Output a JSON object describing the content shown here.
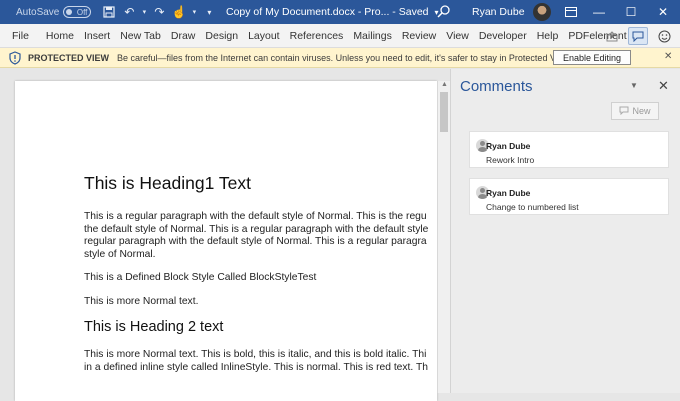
{
  "titlebar": {
    "autosave_label": "AutoSave",
    "autosave_state": "Off",
    "doc_title": "Copy of My Document.docx  -  Pro...  -  Saved",
    "user_name": "Ryan Dube"
  },
  "ribbon": {
    "tabs": [
      "File",
      "Home",
      "Insert",
      "New Tab",
      "Draw",
      "Design",
      "Layout",
      "References",
      "Mailings",
      "Review",
      "View",
      "Developer",
      "Help",
      "PDFelement"
    ]
  },
  "protected_view": {
    "title": "PROTECTED VIEW",
    "message": "Be careful—files from the Internet can contain viruses. Unless you need to edit, it's safer to stay in Protected View.",
    "button": "Enable Editing"
  },
  "document": {
    "heading1": "This is Heading1 Text",
    "para1": [
      "This is a regular paragraph with the default style of Normal. This is the regu",
      "the default style of Normal. This is a regular paragraph with the default style",
      "regular paragraph with the default style of Normal. This is a regular paragra",
      "style of Normal."
    ],
    "para2": "This is a Defined Block Style Called BlockStyleTest",
    "para3": "This is more Normal text.",
    "heading2": "This is Heading 2 text",
    "para4": [
      "This is more Normal text. This is bold, this is italic, and this is bold italic. Thi",
      "in a defined inline style called InlineStyle. This is normal. This is red text. Th"
    ]
  },
  "comments": {
    "title": "Comments",
    "new_label": "New",
    "items": [
      {
        "author": "Ryan Dube",
        "text": "Rework Intro"
      },
      {
        "author": "Ryan Dube",
        "text": "Change to numbered list"
      }
    ]
  },
  "colors": {
    "title_bar": "#2b579a",
    "protected_bar": "#fff4ce",
    "comments_title": "#2b579a"
  }
}
